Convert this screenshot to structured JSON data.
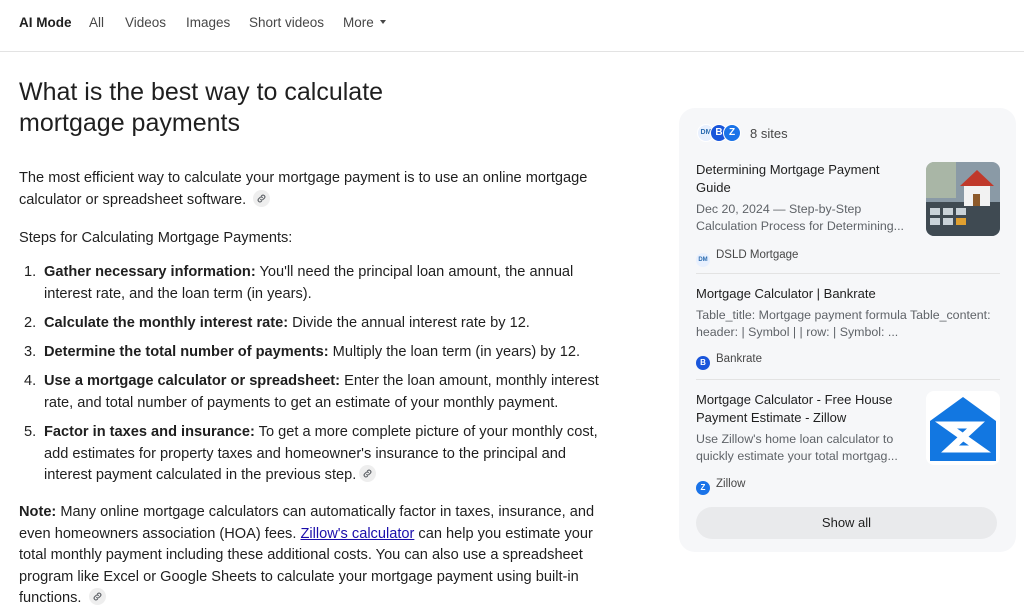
{
  "nav": {
    "tabs": [
      {
        "label": "AI Mode",
        "active": true
      },
      {
        "label": "All"
      },
      {
        "label": "Videos"
      },
      {
        "label": "Images"
      },
      {
        "label": "Short videos"
      },
      {
        "label": "More"
      }
    ]
  },
  "answer": {
    "title": "What is the best way to calculate mortgage payments",
    "intro": "The most efficient way to calculate your mortgage payment is to use an online mortgage calculator or spreadsheet software.",
    "steps_heading": "Steps for Calculating Mortgage Payments:",
    "steps": [
      {
        "num": "1.",
        "bold": "Gather necessary information:",
        "text": " You'll need the principal loan amount, the annual interest rate, and the loan term (in years)."
      },
      {
        "num": "2.",
        "bold": "Calculate the monthly interest rate:",
        "text": " Divide the annual interest rate by 12."
      },
      {
        "num": "3.",
        "bold": "Determine the total number of payments:",
        "text": " Multiply the loan term (in years) by 12."
      },
      {
        "num": "4.",
        "bold": "Use a mortgage calculator or spreadsheet:",
        "text": " Enter the loan amount, monthly interest rate, and total number of payments to get an estimate of your monthly payment."
      },
      {
        "num": "5.",
        "bold": "Factor in taxes and insurance:",
        "text": " To get a more complete picture of your monthly cost, add estimates for property taxes and homeowner's insurance to the principal and interest payment calculated in the previous step."
      }
    ],
    "note": {
      "label": "Note:",
      "text_before": " Many online mortgage calculators can automatically factor in taxes, insurance, and even homeowners association (HOA) fees. ",
      "link": "Zillow's calculator",
      "text_after": " can help you estimate your total monthly payment including these additional costs. You can also use a spreadsheet program like Excel or Google Sheets to calculate your mortgage payment using built-in functions."
    }
  },
  "sources": {
    "count_label": "8 sites",
    "favicons": [
      {
        "text": "DM",
        "color": "#e8f0fe"
      },
      {
        "text": "B",
        "color": "#1a56db"
      },
      {
        "text": "Z",
        "color": "#1a73e8"
      }
    ],
    "cards": [
      {
        "title": "Determining Mortgage Payment Guide",
        "snippet": "Dec 20, 2024 — Step-by-Step Calculation Process for Determining...",
        "source": "DSLD Mortgage",
        "fav_text": "DM"
      },
      {
        "title": "Mortgage Calculator | Bankrate",
        "snippet": "Table_title: Mortgage payment formula Table_content: header: | Symbol | | row: | Symbol: ...",
        "source": "Bankrate",
        "fav_text": "B"
      },
      {
        "title": "Mortgage Calculator - Free House Payment Estimate - Zillow",
        "snippet": "Use Zillow's home loan calculator to quickly estimate your total mortgag...",
        "source": "Zillow",
        "fav_text": "Z"
      }
    ],
    "show_all_label": "Show all"
  },
  "colors": {
    "link": "#1a0dab",
    "panel_bg": "#f6f7f9",
    "zillow_blue": "#1277e1",
    "bankrate_blue": "#1a56db"
  }
}
